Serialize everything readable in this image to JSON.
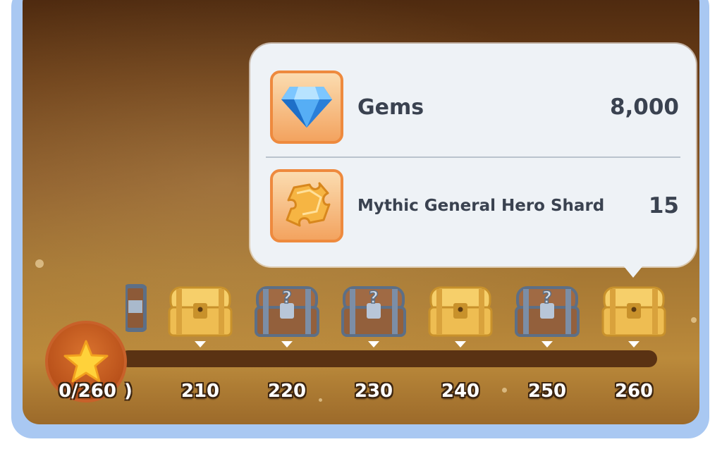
{
  "tooltip": {
    "rewards": [
      {
        "icon": "gem-icon",
        "name": "Gems",
        "amount": "8,000"
      },
      {
        "icon": "puzzle-shard-icon",
        "name": "Mythic General Hero Shard",
        "amount": "15"
      }
    ]
  },
  "progress": {
    "label": "0/260",
    "current": 0,
    "max": 260
  },
  "track": {
    "partial_label": ")",
    "milestones": [
      {
        "label": "210",
        "chest": "gold"
      },
      {
        "label": "220",
        "chest": "mystery"
      },
      {
        "label": "230",
        "chest": "mystery"
      },
      {
        "label": "240",
        "chest": "gold"
      },
      {
        "label": "250",
        "chest": "mystery"
      },
      {
        "label": "260",
        "chest": "gold"
      }
    ]
  },
  "colors": {
    "accent_orange": "#ee8a3e",
    "tooltip_bg": "#eef2f6",
    "text_dark": "#3a4250",
    "frame_blue": "#a9c8f2"
  }
}
